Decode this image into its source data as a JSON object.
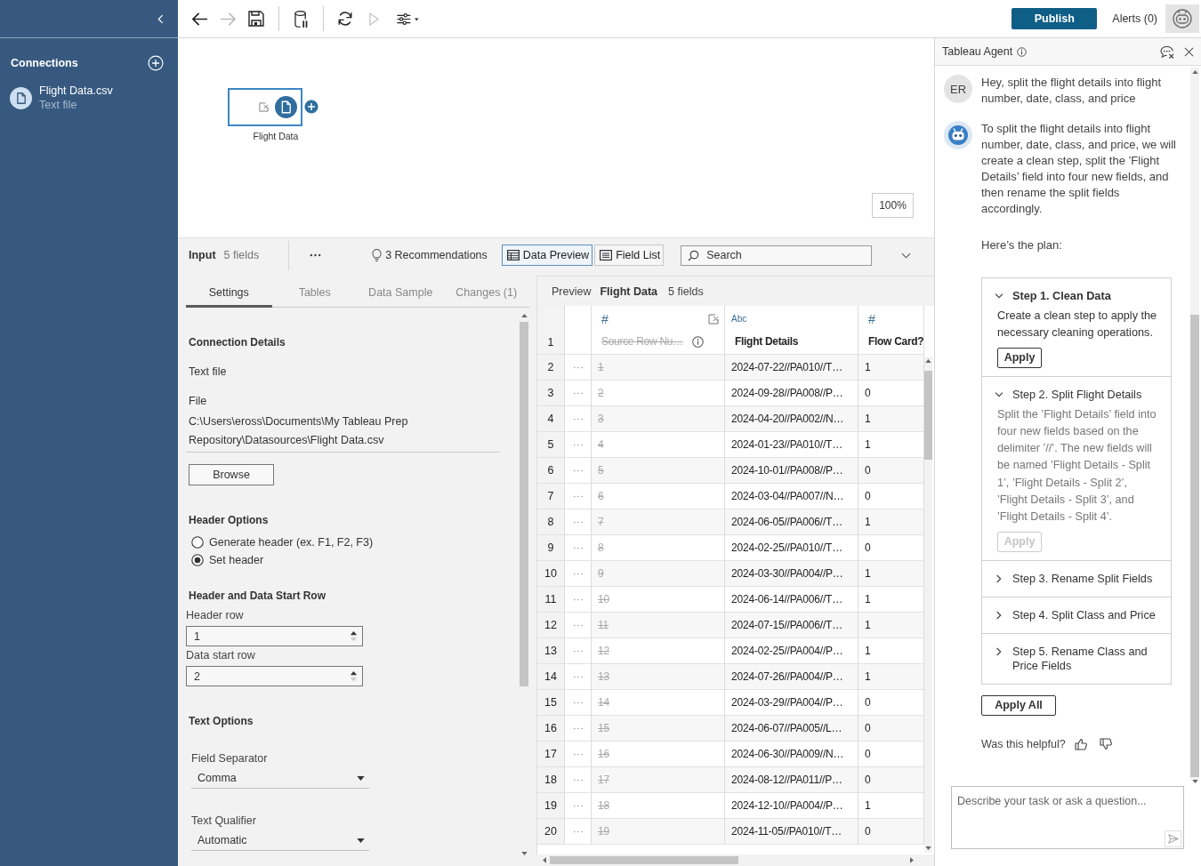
{
  "sidebar": {
    "title": "Connections",
    "connections": [
      {
        "name": "Flight Data.csv",
        "type": "Text file"
      }
    ]
  },
  "toolbar": {
    "tool_groups": [
      [
        {
          "kind": "back",
          "disabled": false
        },
        {
          "kind": "forward",
          "disabled": true
        },
        {
          "kind": "save",
          "disabled": false
        }
      ],
      [
        {
          "kind": "pause-data",
          "disabled": false
        }
      ],
      [
        {
          "kind": "refresh",
          "disabled": false
        },
        {
          "kind": "run",
          "disabled": true
        },
        {
          "kind": "options",
          "disabled": false
        }
      ]
    ],
    "publish": "Publish",
    "alerts": "Alerts (0)"
  },
  "canvas": {
    "nodes": [
      {
        "label": "Flight Data",
        "selected": true
      }
    ],
    "zoom": "100%"
  },
  "input_panel": {
    "toolbar": {
      "title": "Input",
      "field_count": "5 fields",
      "recommendations": "3 Recommendations",
      "views": [
        {
          "kind": "table",
          "label": "Data Preview",
          "selected": true
        },
        {
          "kind": "list",
          "label": "Field List",
          "selected": false
        }
      ],
      "search": {
        "placeholder": "Search"
      }
    },
    "tabs": [
      {
        "label": "Settings",
        "selected": true
      },
      {
        "label": "Tables",
        "selected": false
      },
      {
        "label": "Data Sample",
        "selected": false
      },
      {
        "label": "Changes (1)",
        "selected": false
      }
    ],
    "settings": {
      "connection": {
        "heading": "Connection Details",
        "type": "Text file",
        "file_label": "File",
        "file_path": "C:\\Users\\eross\\Documents\\My Tableau Prep Repository\\Datasources\\Flight Data.csv",
        "browse": "Browse"
      },
      "header_options": {
        "heading": "Header Options",
        "options": [
          {
            "label": "Generate header (ex. F1, F2, F3)",
            "selected": false
          },
          {
            "label": "Set header",
            "selected": true
          }
        ]
      },
      "start_rows": {
        "heading": "Header and Data Start Row",
        "fields": [
          {
            "label": "Header row",
            "value": "1"
          },
          {
            "label": "Data start row",
            "value": "2"
          }
        ]
      },
      "text_options": {
        "heading": "Text Options",
        "dropdowns": [
          {
            "label": "Field Separator",
            "value": "Comma"
          },
          {
            "label": "Text Qualifier",
            "value": "Automatic"
          }
        ]
      }
    }
  },
  "preview": {
    "label": "Preview",
    "name": "Flight Data",
    "field_count": "5 fields",
    "header_row": "1",
    "columns": [
      {
        "kind": "number",
        "type": "#",
        "name": "Source Row Nu…",
        "removed": true
      },
      {
        "kind": "string",
        "type": "Abc",
        "name": "Flight Details",
        "removed": false
      },
      {
        "kind": "number",
        "type": "#",
        "name": "Flow Card?",
        "removed": false
      }
    ],
    "rows": [
      {
        "row": "2",
        "cells": [
          "1",
          "2024-07-22//PA010//T…",
          "1"
        ]
      },
      {
        "row": "3",
        "cells": [
          "2",
          "2024-09-28//PA008//P…",
          "0"
        ]
      },
      {
        "row": "4",
        "cells": [
          "3",
          "2024-04-20//PA002//N…",
          "1"
        ]
      },
      {
        "row": "5",
        "cells": [
          "4",
          "2024-01-23//PA010//T…",
          "1"
        ]
      },
      {
        "row": "6",
        "cells": [
          "5",
          "2024-10-01//PA008//P…",
          "0"
        ]
      },
      {
        "row": "7",
        "cells": [
          "6",
          "2024-03-04//PA007//N…",
          "0"
        ]
      },
      {
        "row": "8",
        "cells": [
          "7",
          "2024-06-05//PA006//T…",
          "1"
        ]
      },
      {
        "row": "9",
        "cells": [
          "8",
          "2024-02-25//PA010//T…",
          "0"
        ]
      },
      {
        "row": "10",
        "cells": [
          "9",
          "2024-03-30//PA004//P…",
          "1"
        ]
      },
      {
        "row": "11",
        "cells": [
          "10",
          "2024-06-14//PA006//T…",
          "1"
        ]
      },
      {
        "row": "12",
        "cells": [
          "11",
          "2024-07-15//PA006//T…",
          "1"
        ]
      },
      {
        "row": "13",
        "cells": [
          "12",
          "2024-02-25//PA004//P…",
          "1"
        ]
      },
      {
        "row": "14",
        "cells": [
          "13",
          "2024-07-26//PA004//P…",
          "1"
        ]
      },
      {
        "row": "15",
        "cells": [
          "14",
          "2024-03-29//PA004//P…",
          "0"
        ]
      },
      {
        "row": "16",
        "cells": [
          "15",
          "2024-06-07//PA005//L…",
          "0"
        ]
      },
      {
        "row": "17",
        "cells": [
          "16",
          "2024-06-30//PA009//N…",
          "0"
        ]
      },
      {
        "row": "18",
        "cells": [
          "17",
          "2024-08-12//PA011//P…",
          "0"
        ]
      },
      {
        "row": "19",
        "cells": [
          "18",
          "2024-12-10//PA004//P…",
          "1"
        ]
      },
      {
        "row": "20",
        "cells": [
          "19",
          "2024-11-05//PA010//T…",
          "0"
        ]
      }
    ]
  },
  "agent": {
    "title": "Tableau Agent",
    "messages": [
      {
        "kind": "user",
        "avatar": "ER",
        "paragraphs": [
          "Hey, split the flight details into flight number, date, class, and price"
        ]
      },
      {
        "kind": "agent",
        "paragraphs": [
          "To split the flight details into flight number, date, class, and price, we will create a clean step, split the ’Flight Details’ field into four new fields, and then rename the split fields accordingly.",
          "Here’s the plan:"
        ]
      }
    ],
    "steps": [
      {
        "title": "Step 1. Clean Data",
        "active": true,
        "expanded": true,
        "description": "Create a clean step to apply the necessary cleaning operations.",
        "apply": {
          "label": "Apply",
          "disabled": false
        }
      },
      {
        "title": "Step 2. Split Flight Details",
        "active": false,
        "expanded": true,
        "description": "Split the ’Flight Details’ field into four new fields based on the delimiter ’//’. The new fields will be named ’Flight Details - Split 1’, ’Flight Details - Split 2’, ’Flight Details - Split 3’, and ’Flight Details - Split 4’.",
        "apply": {
          "label": "Apply",
          "disabled": true
        }
      },
      {
        "title": "Step 3. Rename Split Fields",
        "active": false,
        "expanded": false
      },
      {
        "title": "Step 4. Split Class and Price",
        "active": false,
        "expanded": false
      },
      {
        "title": "Step 5. Rename Class and Price Fields",
        "active": false,
        "expanded": false
      }
    ],
    "apply_all": "Apply All",
    "feedback": "Was this helpful?",
    "input": {
      "placeholder": "Describe your task or ask a question..."
    }
  }
}
